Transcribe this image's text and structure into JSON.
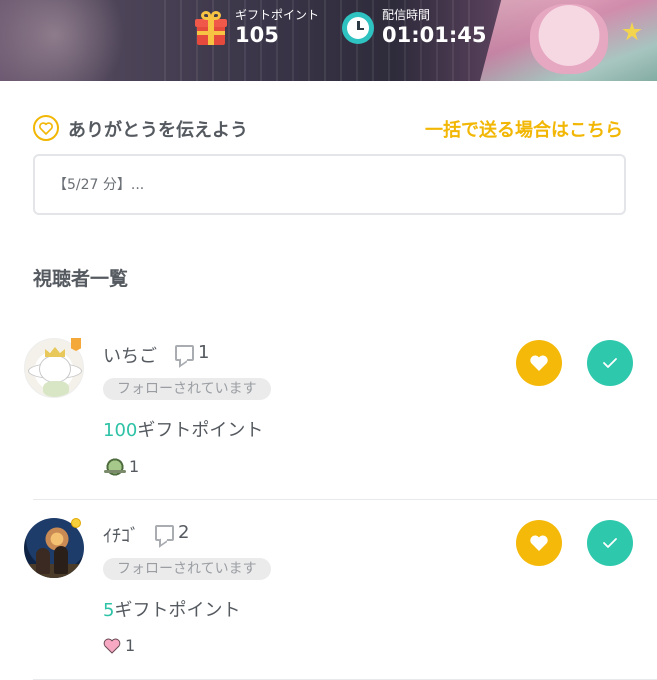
{
  "header": {
    "gift_points_label": "ギフトポイント",
    "gift_points_value": "105",
    "broadcast_time_label": "配信時間",
    "broadcast_time_value": "01:01:45"
  },
  "thanks": {
    "title": "ありがとうを伝えよう",
    "bulk_send_link": "一括で送る場合はこちら",
    "message_value": "",
    "message_placeholder": "【5/27 分】..."
  },
  "viewers_section": {
    "title": "視聴者一覧"
  },
  "viewers": [
    {
      "name": "いちご",
      "comment_count": "1",
      "follow_status": "フォローされています",
      "points_number": "100",
      "points_suffix": "ギフトポイント",
      "gift_item_icon": "bug-sticker-icon",
      "gift_item_count": "1"
    },
    {
      "name": "ｲﾁｺﾞ",
      "comment_count": "2",
      "follow_status": "フォローされています",
      "points_number": "5",
      "points_suffix": "ギフトポイント",
      "gift_item_icon": "pink-heart-icon",
      "gift_item_count": "1"
    }
  ],
  "colors": {
    "accent_yellow": "#f5b90a",
    "accent_teal": "#2ec8ad",
    "text_primary": "#555a60",
    "follow_badge_bg": "#ebebeb"
  }
}
